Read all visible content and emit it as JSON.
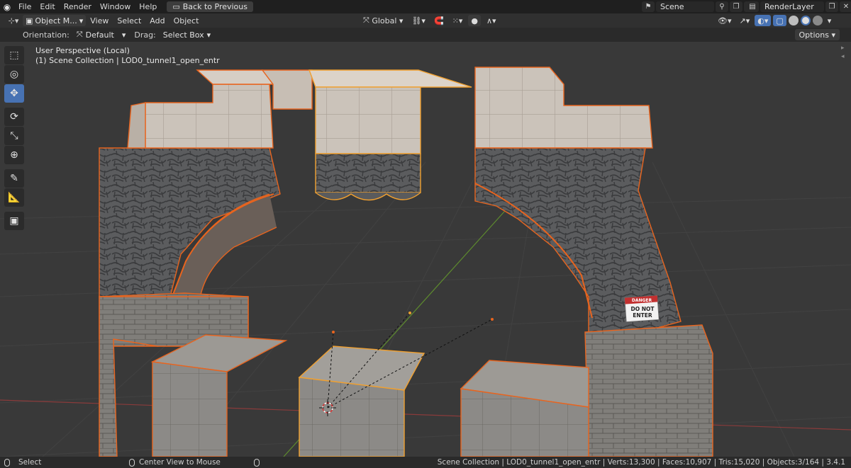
{
  "topbar": {
    "menus": [
      "File",
      "Edit",
      "Render",
      "Window",
      "Help"
    ],
    "back_label": "Back to Previous",
    "scene": "Scene",
    "render_layer": "RenderLayer"
  },
  "header": {
    "mode": "Object M...",
    "menus": [
      "View",
      "Select",
      "Add",
      "Object"
    ],
    "transform_orientation": "Global"
  },
  "toolsettings": {
    "orientation_label": "Orientation:",
    "orientation_value": "Default",
    "drag_label": "Drag:",
    "drag_value": "Select Box",
    "options_label": "Options"
  },
  "viewport": {
    "perspective": "User Perspective (Local)",
    "collection_line": "(1) Scene Collection | LOD0_tunnel1_open_entr",
    "sign_lines": [
      "DANGER",
      "DO NOT",
      "ENTER"
    ]
  },
  "toolbar": {
    "tools": [
      {
        "icon": "select-box-icon",
        "glyph": "⬚",
        "active": false
      },
      {
        "icon": "cursor-icon",
        "glyph": "◎",
        "active": false
      },
      {
        "icon": "move-icon",
        "glyph": "✥",
        "active": true
      },
      {
        "icon": "rotate-icon",
        "glyph": "⟳",
        "active": false
      },
      {
        "icon": "scale-icon",
        "glyph": "⤡",
        "active": false
      },
      {
        "icon": "transform-icon",
        "glyph": "⊕",
        "active": false
      },
      {
        "icon": "annotate-icon",
        "glyph": "✎",
        "active": false
      },
      {
        "icon": "measure-icon",
        "glyph": "📐",
        "active": false
      },
      {
        "icon": "add-cube-icon",
        "glyph": "▣",
        "active": false
      }
    ]
  },
  "statusbar": {
    "select": "Select",
    "center_view": "Center View to Mouse",
    "stats": "Scene Collection | LOD0_tunnel1_open_entr | Verts:13,300 | Faces:10,907 | Tris:15,020 | Objects:3/164 | 3.4.1"
  },
  "colors": {
    "selection_outline": "#e8641e",
    "active_outline": "#f0a030",
    "accent": "#4772b3"
  }
}
